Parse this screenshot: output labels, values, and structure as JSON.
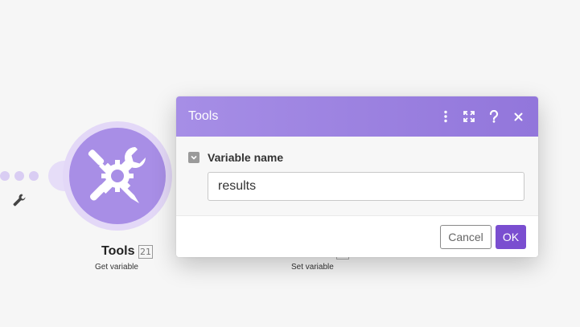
{
  "canvas": {
    "previous_connector": {
      "icon": "wrench-icon"
    },
    "module": {
      "title": "Tools",
      "badge": "21",
      "subtitle": "Get variable",
      "icon": "tools-icon",
      "color": "#a88ee6"
    },
    "next_module": {
      "subtitle": "Set variable"
    }
  },
  "modal": {
    "title": "Tools",
    "header_color": "#9b82e0",
    "header_icons": [
      "more-vertical-icon",
      "expand-icon",
      "help-icon",
      "close-icon"
    ],
    "field": {
      "label": "Variable name",
      "value": "results",
      "collapse_icon": "chevron-down-icon"
    },
    "buttons": {
      "cancel_label": "Cancel",
      "ok_label": "OK",
      "ok_color": "#7a4ed0"
    }
  }
}
